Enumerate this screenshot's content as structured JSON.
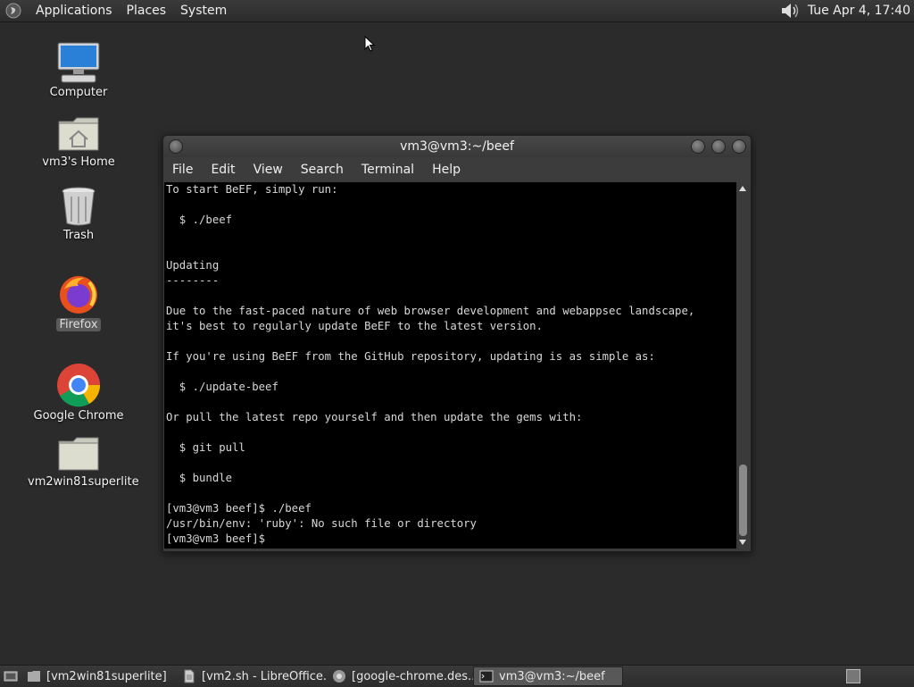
{
  "top_panel": {
    "menus": [
      "Applications",
      "Places",
      "System"
    ],
    "clock": "Tue Apr  4, 17:40"
  },
  "desktop_icons": [
    {
      "name": "computer",
      "label": "Computer"
    },
    {
      "name": "home",
      "label": "vm3's Home"
    },
    {
      "name": "trash",
      "label": "Trash"
    },
    {
      "name": "firefox",
      "label": "Firefox"
    },
    {
      "name": "chrome",
      "label": "Google Chrome"
    },
    {
      "name": "folder",
      "label": "vm2win81superlite"
    }
  ],
  "terminal": {
    "title": "vm3@vm3:~/beef",
    "menu": [
      "File",
      "Edit",
      "View",
      "Search",
      "Terminal",
      "Help"
    ],
    "lines": [
      "To start BeEF, simply run:",
      "",
      "  $ ./beef",
      "",
      "",
      "Updating",
      "--------",
      "",
      "Due to the fast-paced nature of web browser development and webappsec landscape,",
      "it's best to regularly update BeEF to the latest version.",
      "",
      "If you're using BeEF from the GitHub repository, updating is as simple as:",
      "",
      "  $ ./update-beef",
      "",
      "Or pull the latest repo yourself and then update the gems with:",
      "",
      "  $ git pull",
      "",
      "  $ bundle",
      "",
      "[vm3@vm3 beef]$ ./beef",
      "/usr/bin/env: 'ruby': No such file or directory",
      "[vm3@vm3 beef]$ "
    ]
  },
  "taskbar": {
    "items": [
      {
        "label": "[vm2win81superlite]",
        "icon": "folder-icon"
      },
      {
        "label": "[vm2.sh - LibreOffice...",
        "icon": "document-icon"
      },
      {
        "label": "[google-chrome.des...",
        "icon": "chrome-icon"
      },
      {
        "label": "vm3@vm3:~/beef",
        "icon": "terminal-icon",
        "active": true
      }
    ]
  }
}
